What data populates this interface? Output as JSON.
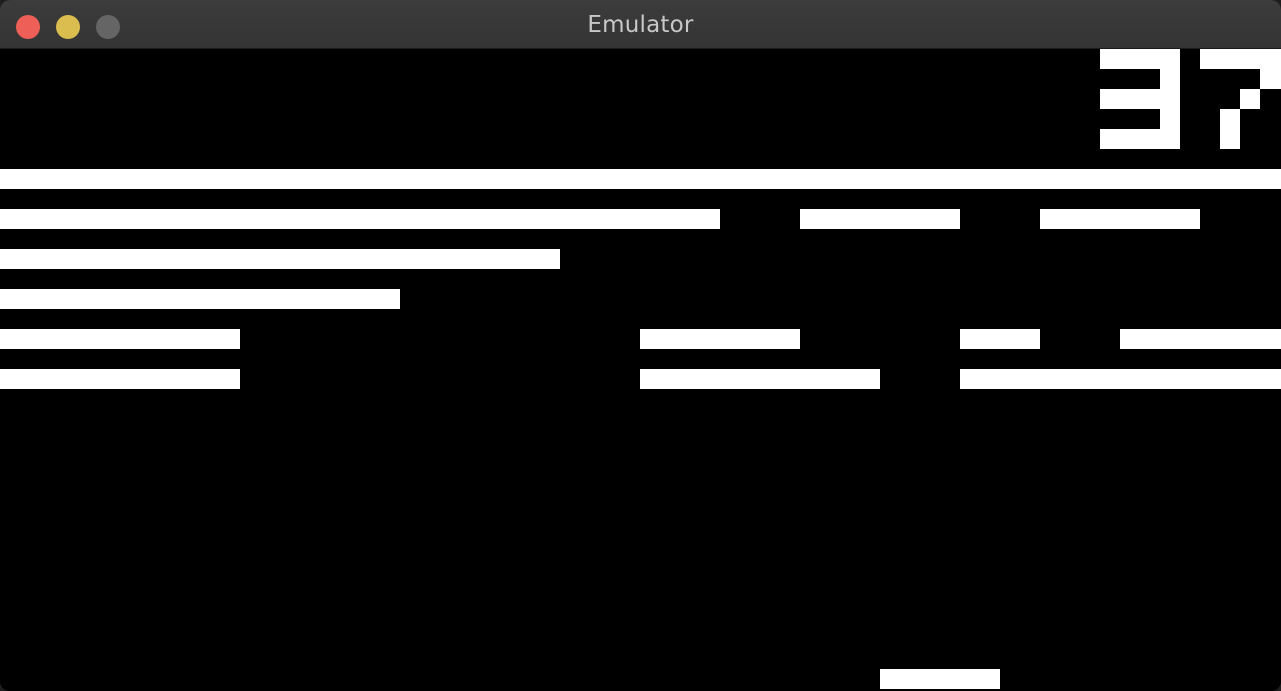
{
  "window": {
    "title": "Emulator",
    "buttons": {
      "close": "close-button",
      "minimize": "minimize-button",
      "zoom": "zoom-button"
    }
  },
  "game": {
    "score": "37",
    "colors": {
      "background": "#000000",
      "foreground": "#ffffff"
    }
  }
}
